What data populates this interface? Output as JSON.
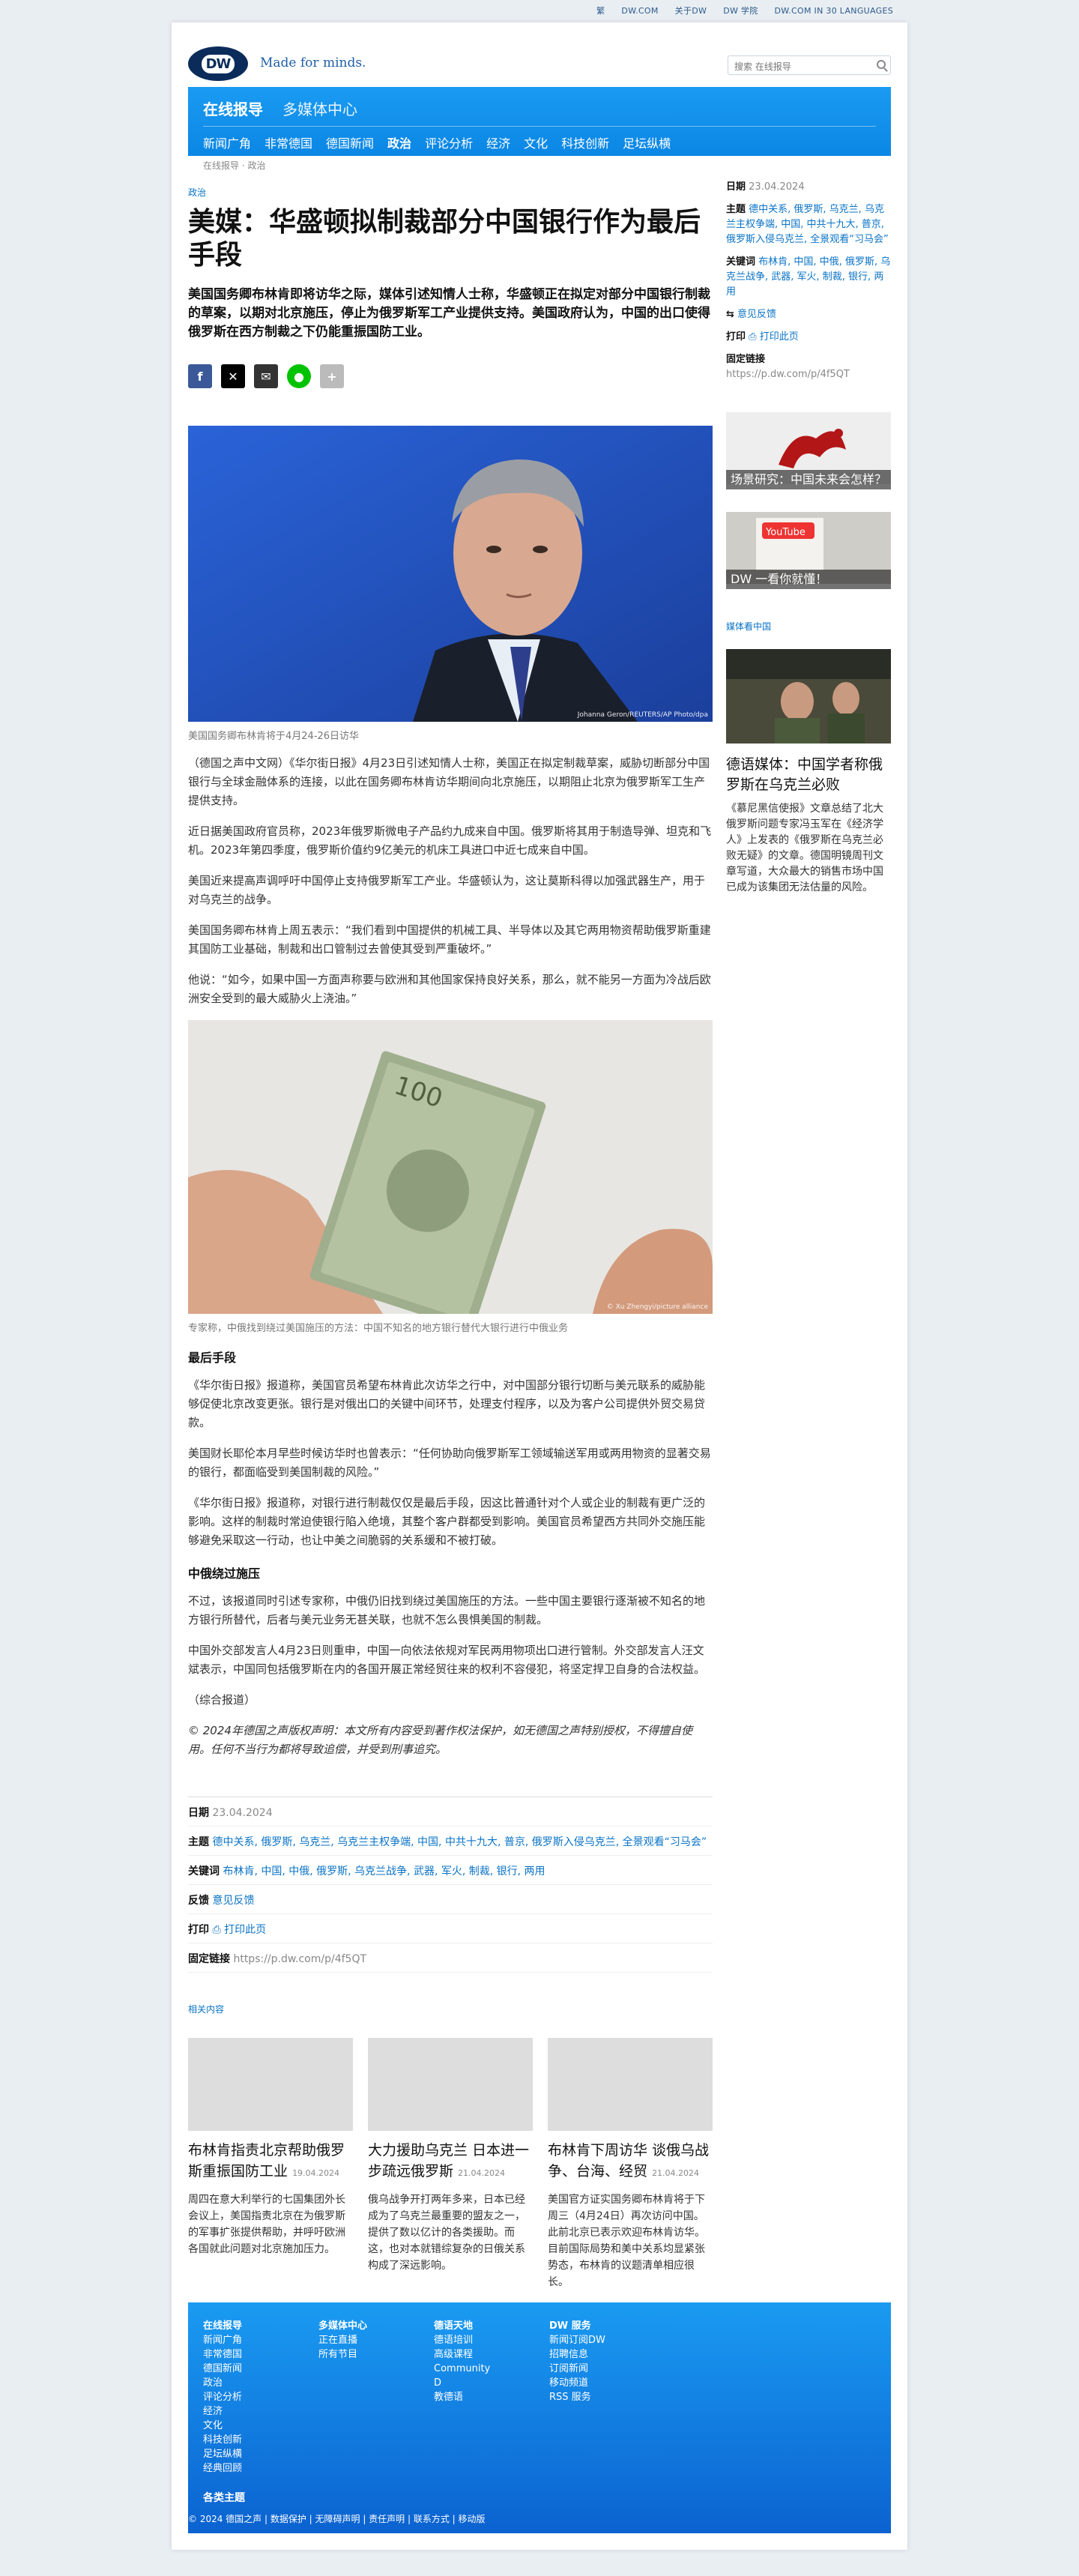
{
  "topbar": {
    "items": [
      "繁",
      "DW.COM",
      "关于DW",
      "DW 学院",
      "DW.COM IN 30 LANGUAGES"
    ]
  },
  "header": {
    "logo": "DW",
    "tagline": "Made for minds.",
    "search_placeholder": "搜索 在线报导"
  },
  "nav": {
    "brand": "在线报导",
    "sub": "多媒体中心",
    "items": [
      "新闻广角",
      "非常德国",
      "德国新闻",
      "政治",
      "评论分析",
      "经济",
      "文化",
      "科技创新",
      "足坛纵横"
    ],
    "active": "政治"
  },
  "breadcrumb": "在线报导 · 政治",
  "article": {
    "section": "政治",
    "headline": "美媒：华盛顿拟制裁部分中国银行作为最后手段",
    "lead": "美国国务卿布林肯即将访华之际，媒体引述知情人士称，华盛顿正在拟定对部分中国银行制裁的草案，以期对北京施压，停止为俄罗斯军工产业提供支持。美国政府认为，中国的出口使得俄罗斯在西方制裁之下仍能重振国防工业。",
    "image1_caption": "美国国务卿布林肯将于4月24-26日访华",
    "image1_credit": "Johanna Geron/REUTERS/AP Photo/dpa",
    "image2_caption": "专家称，中俄找到绕过美国施压的方法：中国不知名的地方银行替代大银行进行中俄业务",
    "image2_credit": "© Xu Zhengyi/picture alliance",
    "paragraphs_a": [
      "（德国之声中文网）《华尔街日报》4月23日引述知情人士称，美国正在拟定制裁草案，威胁切断部分中国银行与全球金融体系的连接，以此在国务卿布林肯访华期间向北京施压，以期阻止北京为俄罗斯军工生产提供支持。",
      "近日据美国政府官员称，2023年俄罗斯微电子产品约九成来自中国。俄罗斯将其用于制造导弹、坦克和飞机。2023年第四季度，俄罗斯价值约9亿美元的机床工具进口中近七成来自中国。",
      "美国近来提高声调呼吁中国停止支持俄罗斯军工产业。华盛顿认为，这让莫斯科得以加强武器生产，用于对乌克兰的战争。",
      "美国国务卿布林肯上周五表示：“我们看到中国提供的机械工具、半导体以及其它两用物资帮助俄罗斯重建其国防工业基础，制裁和出口管制过去曾使其受到严重破坏。”",
      "他说：“如今，如果中国一方面声称要与欧洲和其他国家保持良好关系，那么，就不能另一方面为冷战后欧洲安全受到的最大威胁火上浇油。”"
    ],
    "subhead1": "最后手段",
    "paragraphs_b": [
      "《华尔街日报》报道称，美国官员希望布林肯此次访华之行中，对中国部分银行切断与美元联系的威胁能够促使北京改变更张。银行是对俄出口的关键中间环节，处理支付程序，以及为客户公司提供外贸交易贷款。",
      "美国财长耶伦本月早些时候访华时也曾表示：“任何协助向俄罗斯军工领域输送军用或两用物资的显著交易的银行，都面临受到美国制裁的风险。”",
      "《华尔街日报》报道称，对银行进行制裁仅仅是最后手段，因这比普通针对个人或企业的制裁有更广泛的影响。这样的制裁时常迫使银行陷入绝境，其整个客户群都受到影响。美国官员希望西方共同外交施压能够避免采取这一行动，也让中美之间脆弱的关系缓和不被打破。"
    ],
    "subhead2": "中俄绕过施压",
    "paragraphs_c": [
      "不过，该报道同时引述专家称，中俄仍旧找到绕过美国施压的方法。一些中国主要银行逐渐被不知名的地方银行所替代，后者与美元业务无甚关联，也就不怎么畏惧美国的制裁。",
      "中国外交部发言人4月23日则重申，中国一向依法依规对军民两用物项出口进行管制。外交部发言人汪文斌表示，中国同包括俄罗斯在内的各国开展正常经贸往来的权利不容侵犯，将坚定捍卫自身的合法权益。",
      "（综合报道）"
    ],
    "copyright": "© 2024年德国之声版权声明：本文所有内容受到著作权法保护，如无德国之声特别授权，不得擅自使用。任何不当行为都将导致追偿，并受到刑事追究。"
  },
  "meta": {
    "date_label": "日期",
    "date": "23.04.2024",
    "topics_label": "主题",
    "topics": "德中关系, 俄罗斯, 乌克兰, 乌克兰主权争端, 中国, 中共十九大, 普京, 俄罗斯入侵乌克兰, 全景观看“习马会”",
    "keywords_label": "关键词",
    "keywords": "布林肯, 中国, 中俄, 俄罗斯, 乌克兰战争, 武器, 军火, 制裁, 银行, 两用",
    "feedback_label": "反馈",
    "feedback": "意见反馈",
    "print_label": "打印",
    "print": "打印此页",
    "permalink_label": "固定链接",
    "permalink": "https://p.dw.com/p/4f5QT"
  },
  "sidebar": {
    "feedback": "意见反馈",
    "promo1": "场景研究：中国未来会怎样？",
    "promo2": "DW 一看你就懂！",
    "section": "媒体看中国",
    "story_title": "德语媒体：中国学者称俄罗斯在乌克兰必败",
    "story_text": "《慕尼黑信使报》文章总结了北大俄罗斯问题专家冯玉军在《经济学人》上发表的《俄罗斯在乌克兰必败无疑》的文章。德国明镜周刊文章写道，大众最大的销售市场中国已成为该集团无法估量的风险。"
  },
  "related": {
    "title": "相关内容",
    "items": [
      {
        "title": "布林肯指责北京帮助俄罗斯重振国防工业",
        "date": "19.04.2024",
        "text": "周四在意大利举行的七国集团外长会议上，美国指责北京在为俄罗斯的军事扩张提供帮助，并呼吁欧洲各国就此问题对北京施加压力。"
      },
      {
        "title": "大力援助乌克兰 日本进一步疏远俄罗斯",
        "date": "21.04.2024",
        "text": "俄乌战争开打两年多来，日本已经成为了乌克兰最重要的盟友之一，提供了数以亿计的各类援助。而这，也对本就错综复杂的日俄关系构成了深远影响。"
      },
      {
        "title": "布林肯下周访华 谈俄乌战争、台海、经贸",
        "date": "21.04.2024",
        "text": "美国官方证实国务卿布林肯将于下周三（4月24日）再次访问中国。此前北京已表示欢迎布林肯访华。目前国际局势和美中关系均显紧张势态，布林肯的议题清单相应很长。"
      }
    ]
  },
  "footer": {
    "cols": [
      {
        "head": "在线报导",
        "items": [
          "新闻广角",
          "非常德国",
          "德国新闻",
          "政治",
          "评论分析",
          "经济",
          "文化",
          "科技创新",
          "足坛纵横",
          "经典回顾"
        ]
      },
      {
        "head": "多媒体中心",
        "items": [
          "正在直播",
          "所有节目"
        ]
      },
      {
        "head": "德语天地",
        "items": [
          "德语培训",
          "高级课程",
          "Community D",
          "教德语"
        ]
      },
      {
        "head": "DW 服务",
        "items": [
          "新闻订阅DW",
          "招聘信息",
          "订阅新闻",
          "移动频道",
          "RSS 服务"
        ]
      }
    ],
    "bottom_link": "各类主题",
    "legal": "© 2024 德国之声 | 数据保护 | 无障碍声明 | 责任声明 | 联系方式 | 移动版"
  },
  "colors": {
    "brand_blue": "#0b86e4",
    "link_blue": "#0a73c6",
    "logo_navy": "#0b2c5a"
  }
}
